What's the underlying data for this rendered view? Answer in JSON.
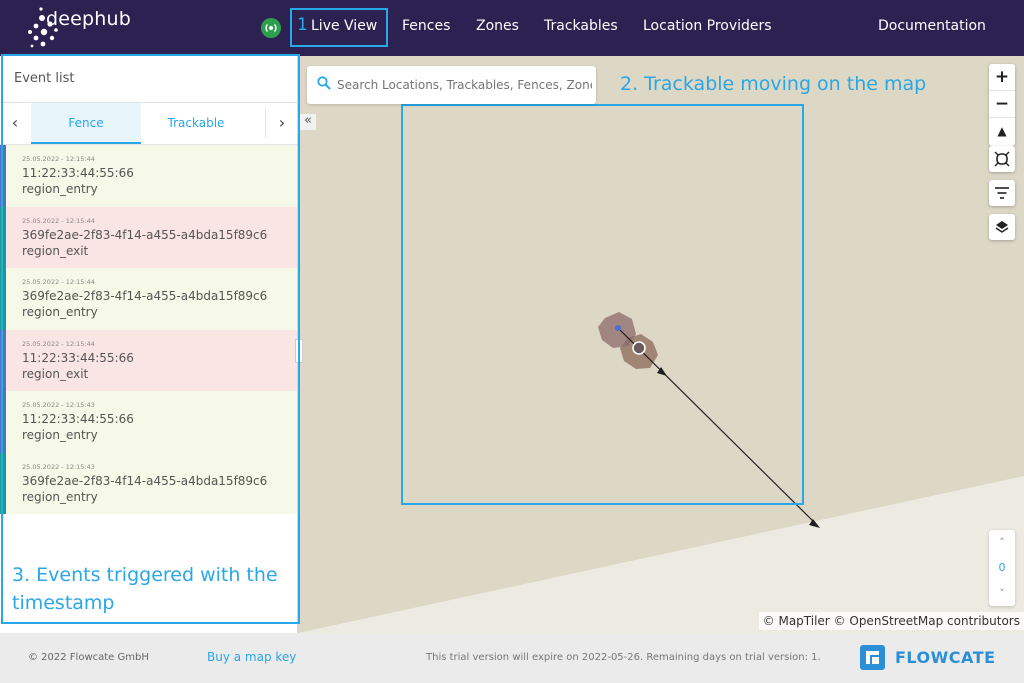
{
  "header": {
    "logo_text": "deephub",
    "live_view_number": "1",
    "nav": {
      "live_view": "Live View",
      "fences": "Fences",
      "zones": "Zones",
      "trackables": "Trackables",
      "location_providers": "Location Providers",
      "documentation": "Documentation"
    }
  },
  "map": {
    "search_placeholder": "Search Locations, Trackables, Fences, Zones",
    "zoom_in": "+",
    "zoom_out": "−",
    "compass": "▲",
    "floor_up": "˄",
    "floor_value": "0",
    "floor_down": "˅",
    "collapse": "«",
    "attribution": "© MapTiler © OpenStreetMap contributors",
    "note": "2. Trackable moving on the map",
    "icons": [
      "zoom-in-icon",
      "zoom-out-icon",
      "compass-icon",
      "fit-bounds-icon",
      "filter-icon",
      "layers-icon",
      "search-icon"
    ]
  },
  "sidebar": {
    "title": "Event list",
    "tabs": [
      "Fence",
      "Trackable"
    ],
    "active_tab": "Fence",
    "prev": "‹",
    "next": "›",
    "events": [
      {
        "timestamp": "25.05.2022 - 12:15:44",
        "id": "11:22:33:44:55:66",
        "type": "region_entry"
      },
      {
        "timestamp": "25.05.2022 - 12:15:44",
        "id": "369fe2ae-2f83-4f14-a455-a4bda15f89c6",
        "type": "region_exit"
      },
      {
        "timestamp": "25.05.2022 - 12:15:44",
        "id": "369fe2ae-2f83-4f14-a455-a4bda15f89c6",
        "type": "region_entry"
      },
      {
        "timestamp": "25.05.2022 - 12:15:44",
        "id": "11:22:33:44:55:66",
        "type": "region_exit"
      },
      {
        "timestamp": "25.05.2022 - 12:15:43",
        "id": "11:22:33:44:55:66",
        "type": "region_entry"
      },
      {
        "timestamp": "25.05.2022 - 12:15:43",
        "id": "369fe2ae-2f83-4f14-a455-a4bda15f89c6",
        "type": "region_entry"
      }
    ],
    "note": "3. Events triggered with the timestamp"
  },
  "footer": {
    "copyright": "© 2022 Flowcate GmbH",
    "buy_link": "Buy a map key",
    "trial_note": "This trial version will expire on 2022-05-26. Remaining days on trial version: 1.",
    "brand": "FLOWCATE"
  },
  "colors": {
    "nav_bg": "#2b2252",
    "accent": "#29a7e6",
    "map_bg": "#ddd7c6",
    "entry_bg": "#f6f8e8",
    "exit_bg": "#fae5e5",
    "live_green": "#2e9e4f"
  }
}
